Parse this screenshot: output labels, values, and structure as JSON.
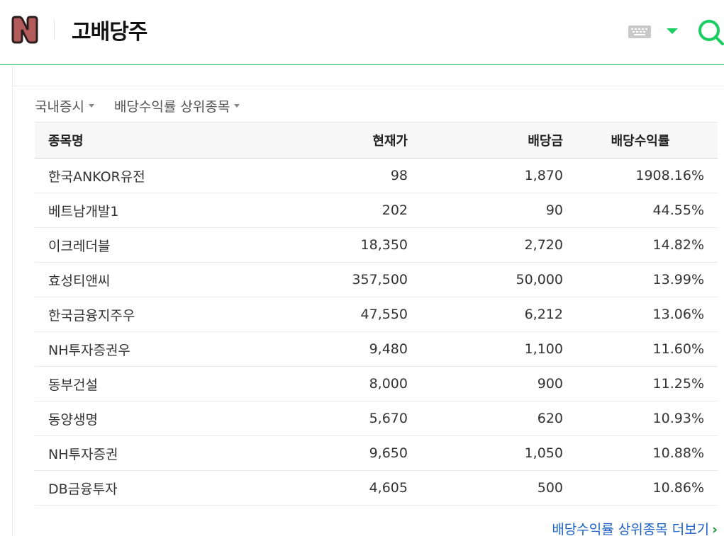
{
  "header": {
    "query": "고배당주",
    "logo_letter": "N"
  },
  "filters": {
    "market": "국내증시",
    "category": "배당수익률 상위종목"
  },
  "table": {
    "headers": [
      "종목명",
      "현재가",
      "배당금",
      "배당수익률"
    ],
    "rows": [
      {
        "name": "한국ANKOR유전",
        "price": "98",
        "dividend": "1,870",
        "yield": "1908.16%"
      },
      {
        "name": "베트남개발1",
        "price": "202",
        "dividend": "90",
        "yield": "44.55%"
      },
      {
        "name": "이크레더블",
        "price": "18,350",
        "dividend": "2,720",
        "yield": "14.82%"
      },
      {
        "name": "효성티앤씨",
        "price": "357,500",
        "dividend": "50,000",
        "yield": "13.99%"
      },
      {
        "name": "한국금융지주우",
        "price": "47,550",
        "dividend": "6,212",
        "yield": "13.06%"
      },
      {
        "name": "NH투자증권우",
        "price": "9,480",
        "dividend": "1,100",
        "yield": "11.60%"
      },
      {
        "name": "동부건설",
        "price": "8,000",
        "dividend": "900",
        "yield": "11.25%"
      },
      {
        "name": "동양생명",
        "price": "5,670",
        "dividend": "620",
        "yield": "10.93%"
      },
      {
        "name": "NH투자증권",
        "price": "9,650",
        "dividend": "1,050",
        "yield": "10.88%"
      },
      {
        "name": "DB금융투자",
        "price": "4,605",
        "dividend": "500",
        "yield": "10.86%"
      }
    ]
  },
  "more_link": "배당수익률 상위종목 더보기",
  "more_chevron": "›",
  "colors": {
    "brand_green": "#19ce60",
    "logo_fill": "#b35b5b",
    "link_blue": "#1a5fc7"
  },
  "icons": [
    "keyboard-icon",
    "dropdown-arrow-icon",
    "search-icon",
    "chevron-right-icon"
  ]
}
